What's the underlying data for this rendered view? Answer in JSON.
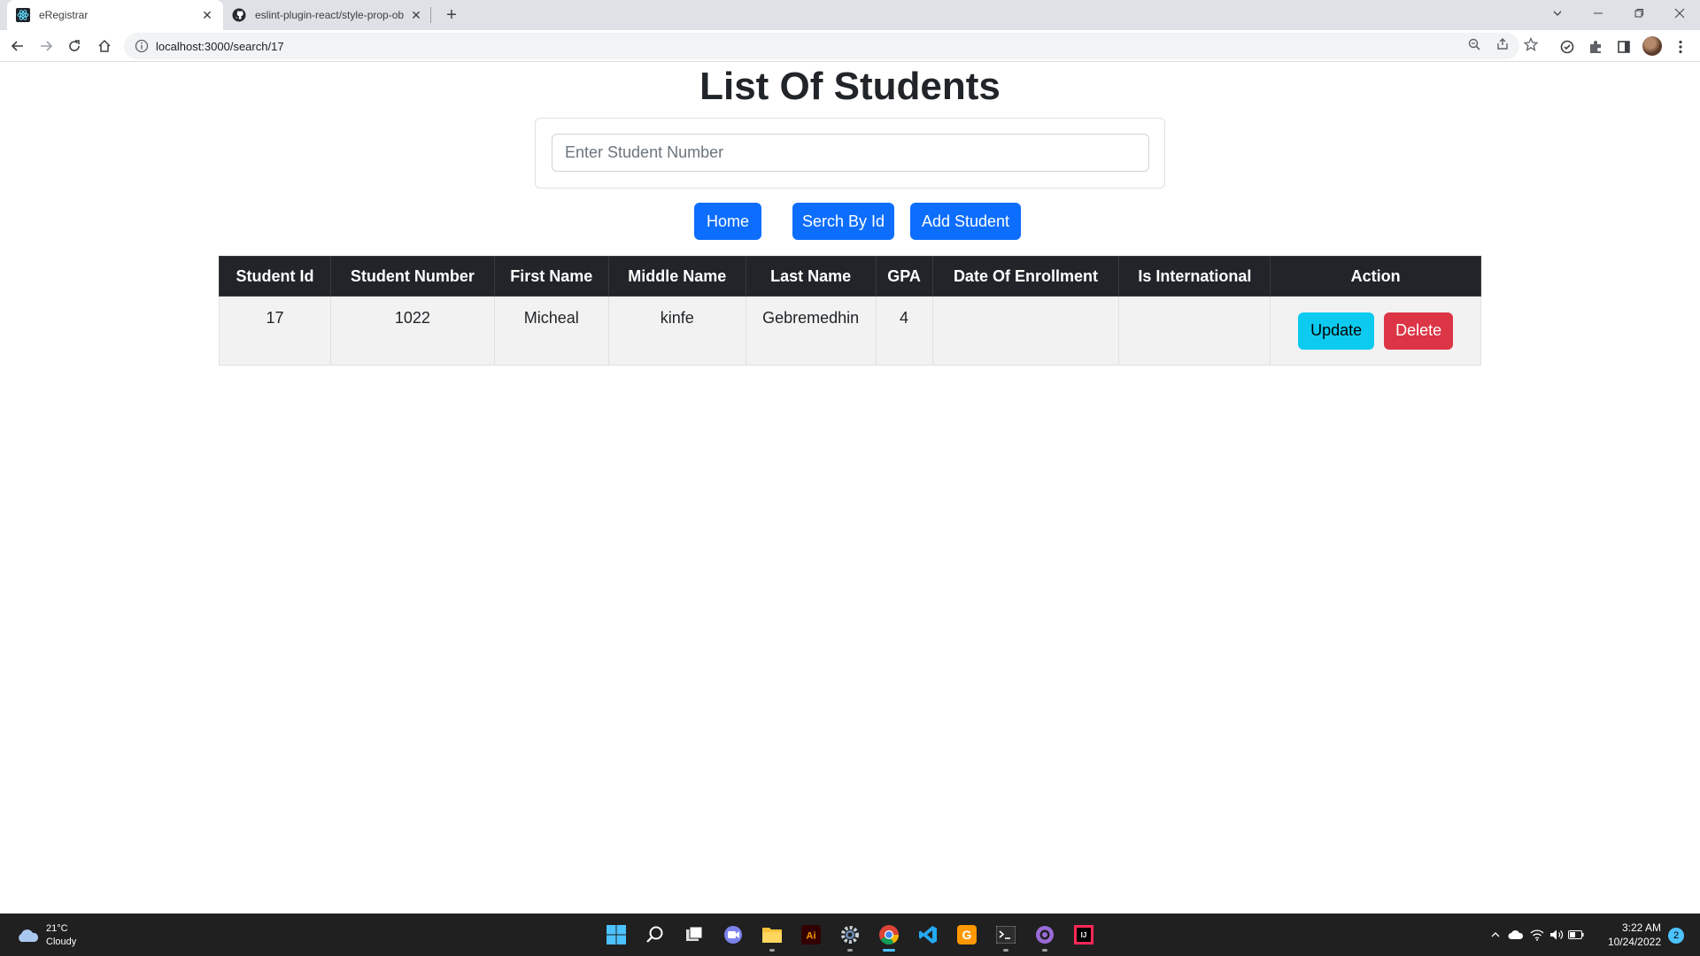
{
  "browser": {
    "tabs": [
      {
        "title": "eRegistrar",
        "active": true,
        "icon": "react-icon"
      },
      {
        "title": "eslint-plugin-react/style-prop-ob",
        "active": false,
        "icon": "github-icon"
      }
    ],
    "address_url": "localhost:3000/search/17"
  },
  "page": {
    "title": "List Of Students",
    "search": {
      "placeholder": "Enter Student Number",
      "value": ""
    },
    "buttons": {
      "home": "Home",
      "search_by_id": "Serch By Id",
      "add_student": "Add Student"
    },
    "table": {
      "headers": [
        "Student Id",
        "Student Number",
        "First Name",
        "Middle Name",
        "Last Name",
        "GPA",
        "Date Of Enrollment",
        "Is International",
        "Action"
      ],
      "rows": [
        {
          "student_id": "17",
          "student_number": "1022",
          "first_name": "Micheal",
          "middle_name": "kinfe",
          "last_name": "Gebremedhin",
          "gpa": "4",
          "date_of_enrollment": "",
          "is_international": "",
          "update_label": "Update",
          "delete_label": "Delete"
        }
      ]
    }
  },
  "taskbar": {
    "weather": {
      "temp": "21°C",
      "condition": "Cloudy"
    },
    "time": "3:22 AM",
    "date": "10/24/2022",
    "notification_count": "2"
  },
  "colors": {
    "primary": "#0d6efd",
    "info": "#0dcaf0",
    "danger": "#dc3545",
    "table_header": "#212529",
    "taskbar": "#202020"
  }
}
